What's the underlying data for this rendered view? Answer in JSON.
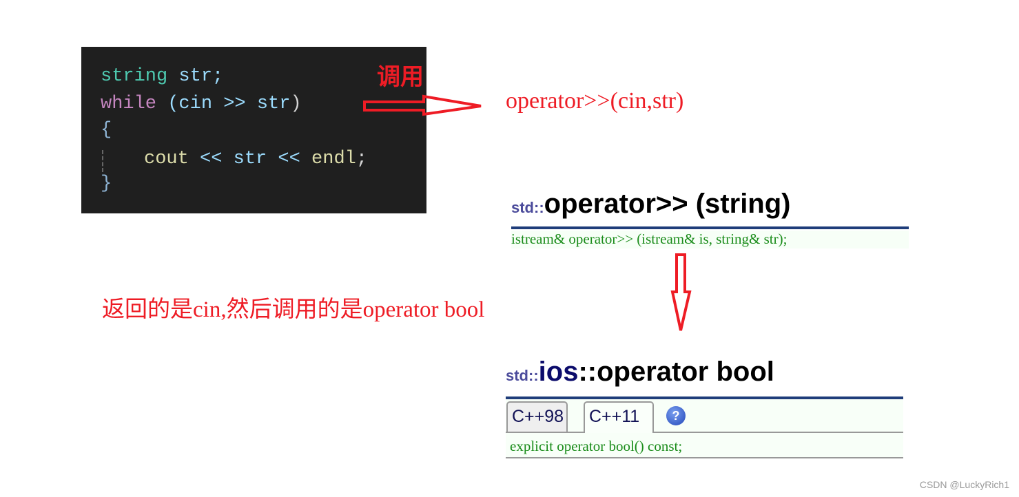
{
  "code": {
    "line1": {
      "type": "string",
      "rest": " str;"
    },
    "line2": {
      "kw": "while",
      "open": " (cin ",
      "op": ">>",
      "var": " str",
      "close": ")"
    },
    "line3": "{",
    "line4": {
      "a": "cout",
      "op1": " << ",
      "b": "str",
      "op2": " << ",
      "c": "endl",
      "end": ";"
    },
    "line5": "}"
  },
  "annotations": {
    "call_label": "调用",
    "call_result": "operator>>(cin,str)",
    "return_note": "返回的是cin,然后调用的是operator bool"
  },
  "ref1": {
    "prefix": "std::",
    "title": "operator>> (string)",
    "declaration": "istream& operator>> (istream& is, string& str);"
  },
  "ref2": {
    "prefix": "std::",
    "class_name": "ios",
    "title": "::operator bool",
    "tabs": [
      {
        "label": "C++98",
        "active": false
      },
      {
        "label": "C++11",
        "active": true
      }
    ],
    "help_icon": "question-mark-icon",
    "declaration": "explicit operator bool() const;"
  },
  "watermark": "CSDN @LuckyRich1",
  "colors": {
    "arrow": "#ee1c25",
    "rule": "#1f3d7a"
  }
}
